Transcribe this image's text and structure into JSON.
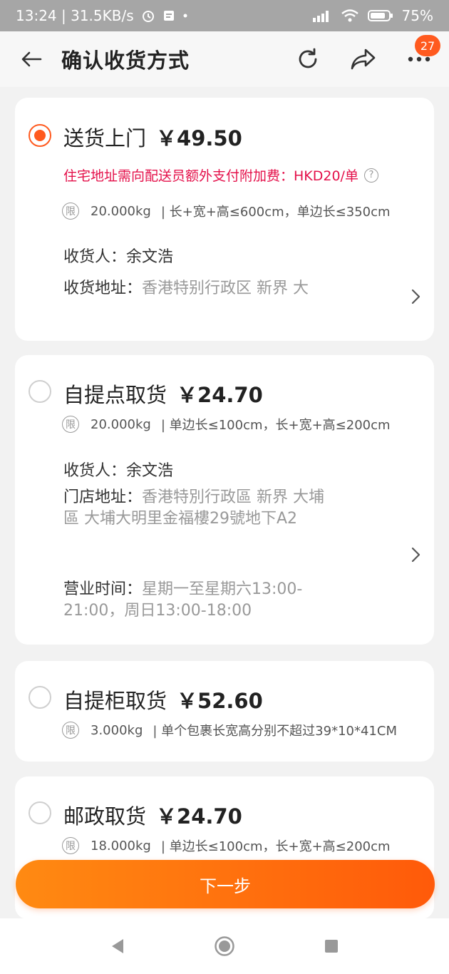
{
  "status_bar": {
    "time_speed": "13:24 | 31.5KB/s",
    "battery": "75%"
  },
  "header": {
    "title": "确认收货方式",
    "badge_count": "27"
  },
  "options": [
    {
      "title": "送货上门",
      "price": "￥49.50",
      "selected": true,
      "surcharge": "住宅地址需向配送员额外支付附加费：HKD20/单",
      "limit_icon": "限",
      "weight": "20.000kg",
      "limit": "| 长+宽+高≤600cm，单边长≤350cm",
      "receiver_label": "收货人：",
      "receiver": "余文浩",
      "address_label": "收货地址：",
      "address": "香港特别行政区 新界 大"
    },
    {
      "title": "自提点取货",
      "price": "￥24.70",
      "selected": false,
      "limit_icon": "限",
      "weight": "20.000kg",
      "limit": "| 单边长≤100cm，长+宽+高≤200cm",
      "receiver_label": "收货人：",
      "receiver": "余文浩",
      "address_label": "门店地址：",
      "address": "香港特別行政區 新界 大埔區 大埔大明里金福樓29號地下A2",
      "hours_label": "营业时间：",
      "hours": "星期一至星期六13:00-21:00，周日13:00-18:00"
    },
    {
      "title": "自提柜取货",
      "price": "￥52.60",
      "selected": false,
      "limit_icon": "限",
      "weight": "3.000kg",
      "limit": "| 单个包裹长宽高分别不超过39*10*41CM"
    },
    {
      "title": "邮政取货",
      "price": "￥24.70",
      "selected": false,
      "limit_icon": "限",
      "weight": "18.000kg",
      "limit": "| 单边长≤100cm，长+宽+高≤200cm"
    }
  ],
  "next_button": "下一步",
  "colors": {
    "accent": "#ff5a1f",
    "surcharge": "#e4104a"
  }
}
